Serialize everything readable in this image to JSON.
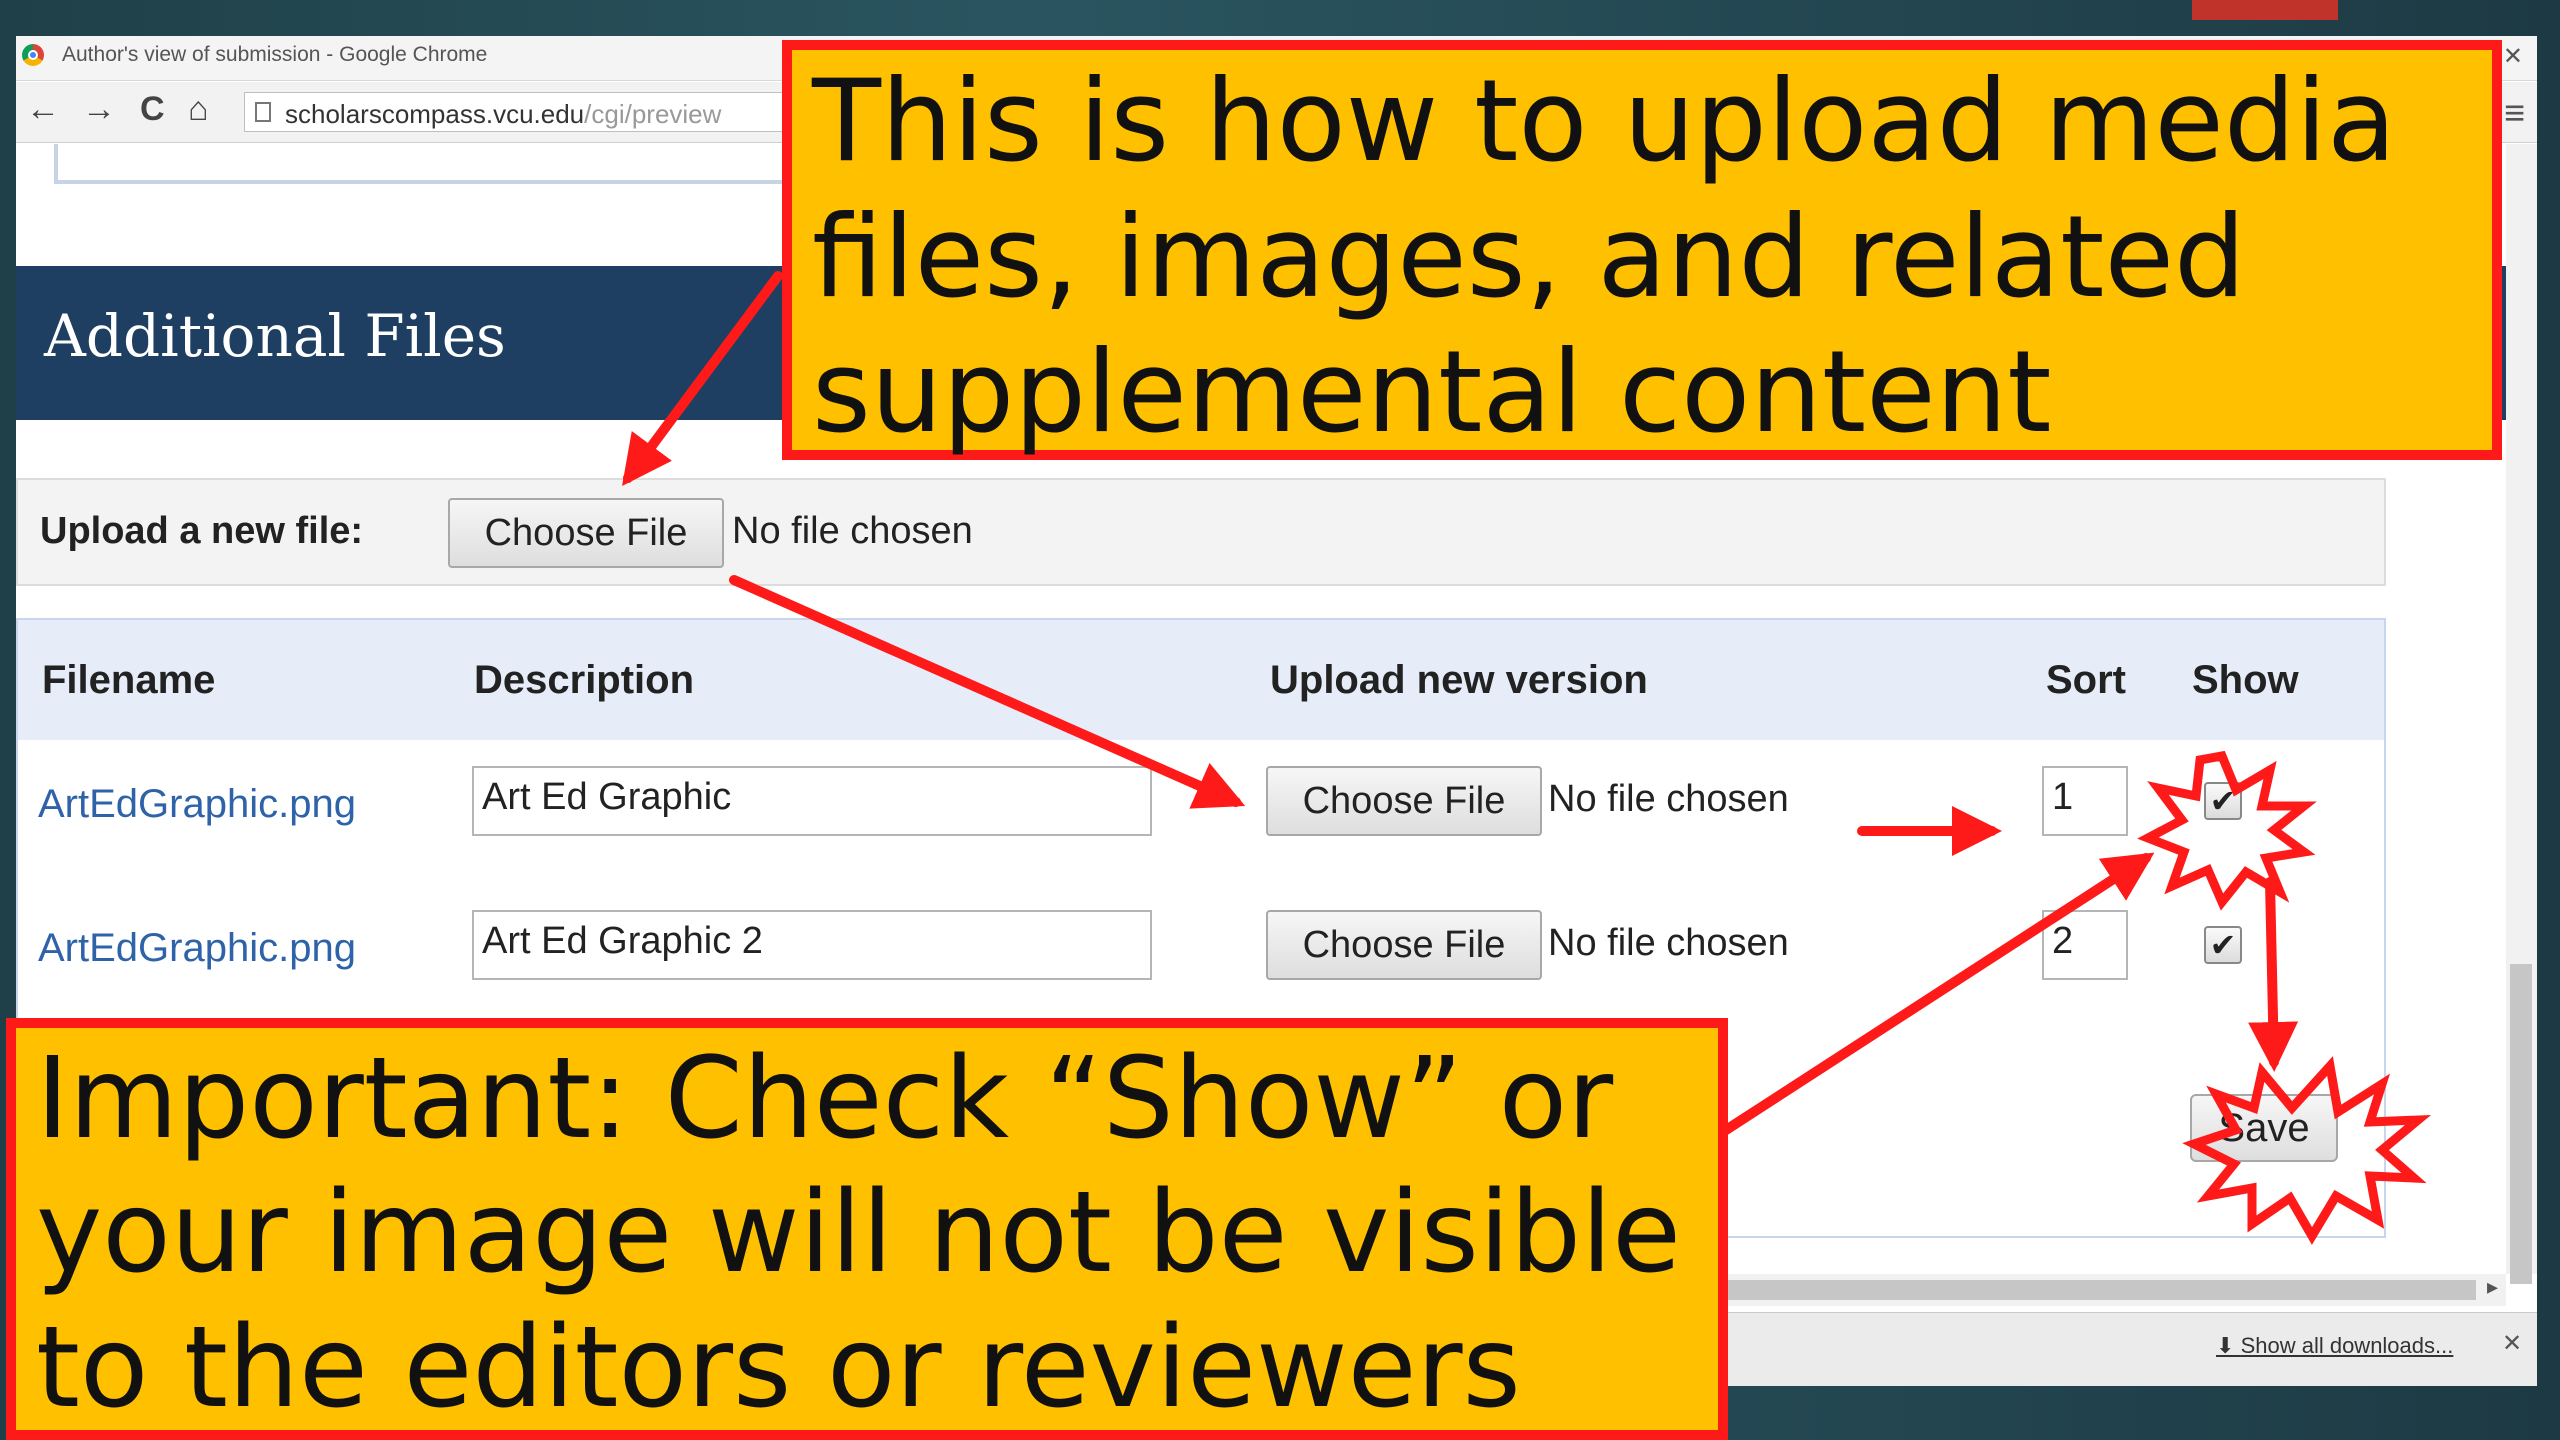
{
  "browser": {
    "window_title": "Author's view of submission - Google Chrome",
    "close_glyph": "✕",
    "url_host": "scholarscompass.vcu.edu",
    "url_path": "/cgi/preview",
    "back_glyph": "←",
    "forward_glyph": "→",
    "reload_glyph": "C",
    "home_glyph": "⌂",
    "menu_glyph": "≡"
  },
  "page": {
    "section_title": "Additional Files",
    "upload_label": "Upload a new file:",
    "choose_file_label": "Choose File",
    "no_file_label": "No file chosen",
    "table": {
      "headers": {
        "filename": "Filename",
        "description": "Description",
        "upload_version": "Upload new version",
        "sort": "Sort",
        "show": "Show"
      },
      "rows": [
        {
          "filename": "ArtEdGraphic.png",
          "description": "Art Ed Graphic",
          "choose_file": "Choose File",
          "no_file": "No file chosen",
          "sort": "1",
          "show": "✔"
        },
        {
          "filename": "ArtEdGraphic.png",
          "description": "Art Ed Graphic 2",
          "choose_file": "Choose File",
          "no_file": "No file chosen",
          "sort": "2",
          "show": "✔"
        }
      ]
    },
    "save_label": "Save"
  },
  "downloads": {
    "show_all_label": "Show all downloads...",
    "download_glyph": "⬇",
    "close_glyph": "✕"
  },
  "annotations": {
    "top_callout": "This is how to upload media files, images, and related supplemental content",
    "bottom_callout": "Important: Check “Show” or your image will not be visible to the editors or reviewers",
    "arrow_color": "#ff1a1a",
    "callout_fill": "#ffc000"
  }
}
